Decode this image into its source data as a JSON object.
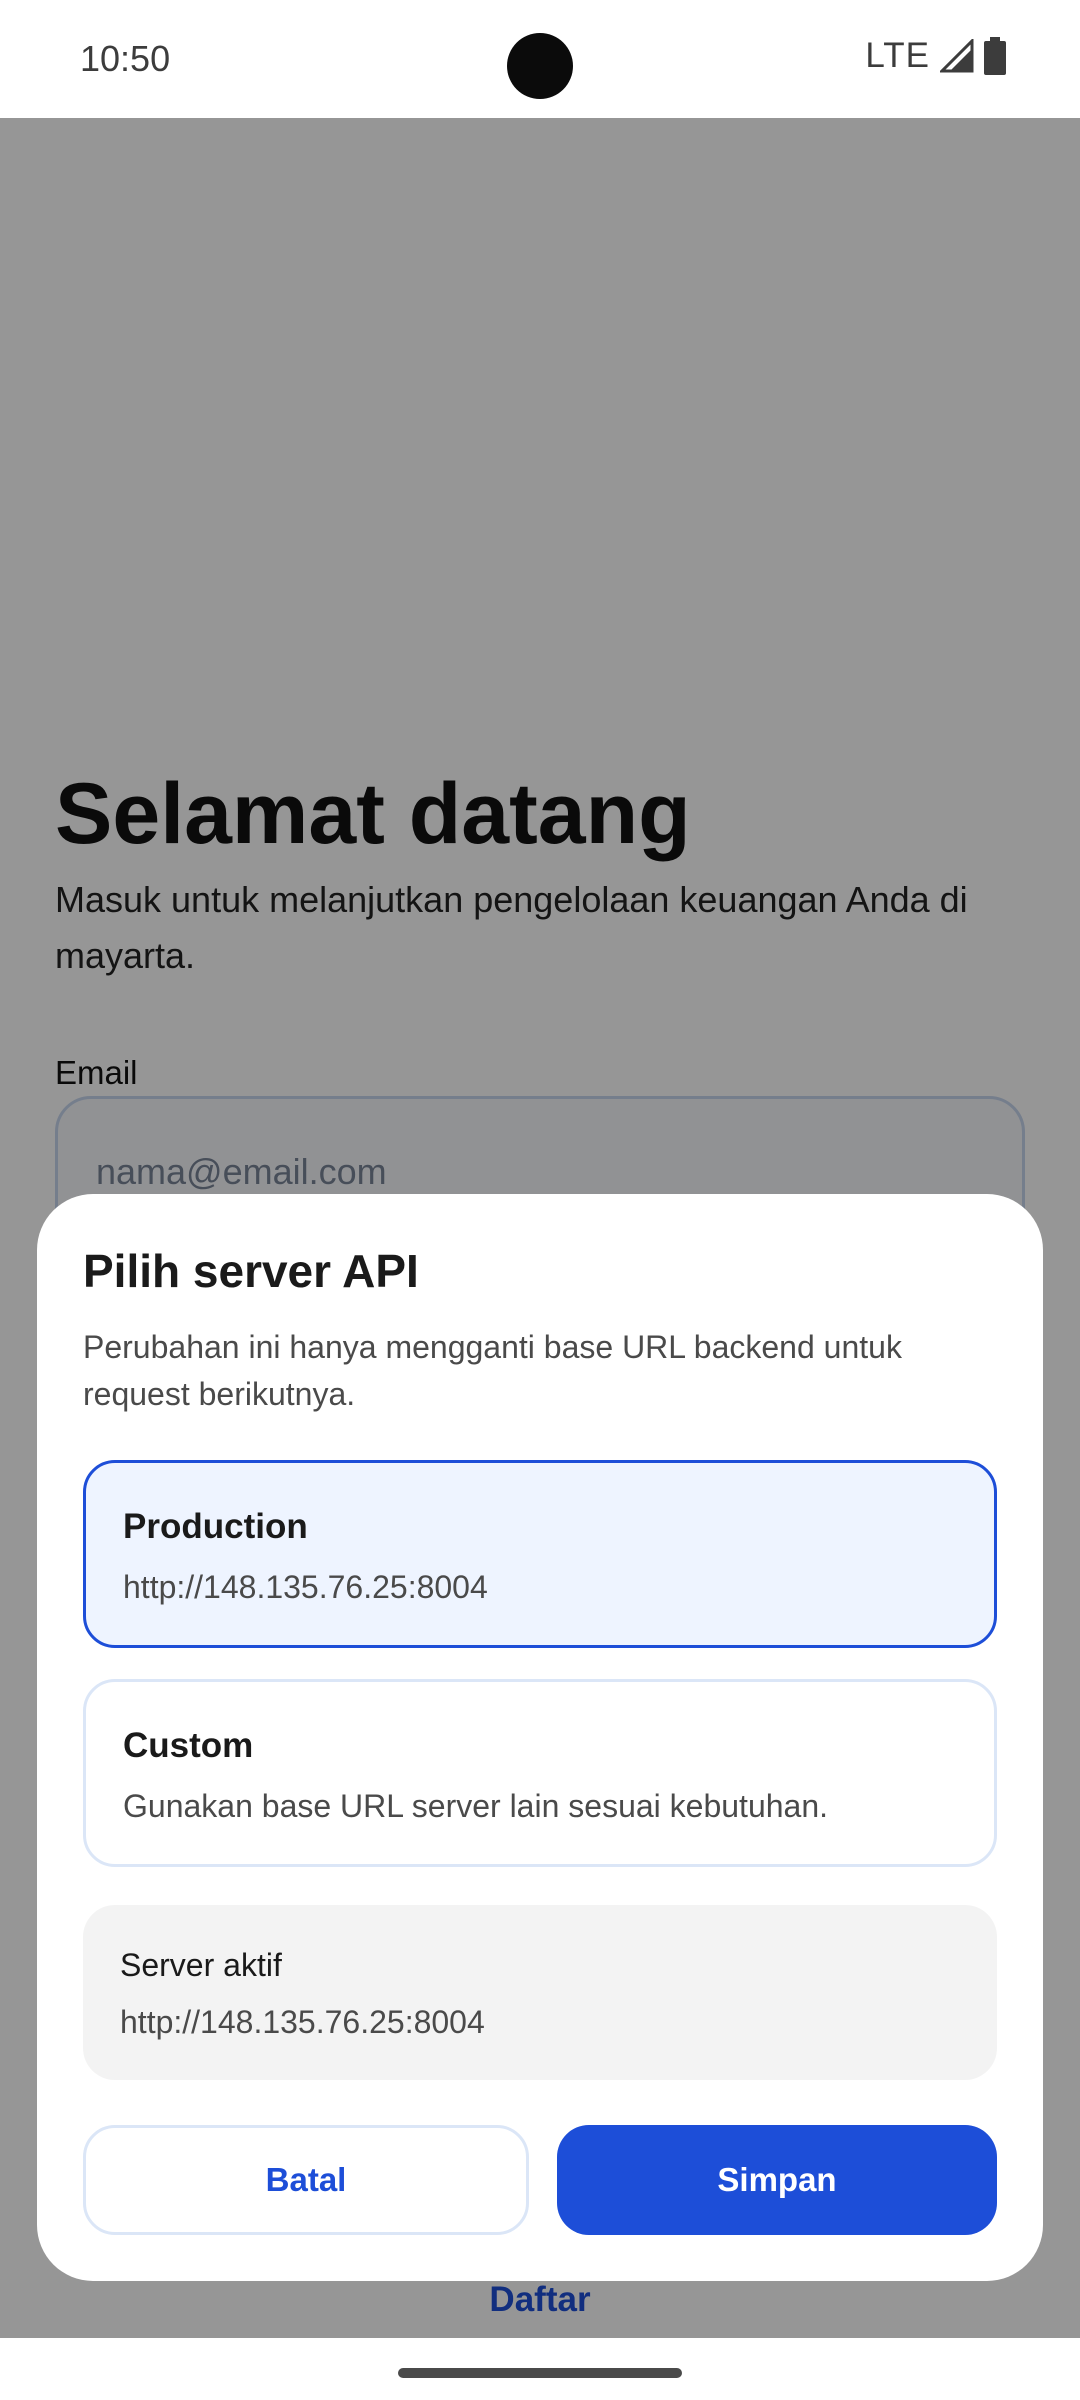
{
  "status_bar": {
    "time": "10:50",
    "network": "LTE"
  },
  "login": {
    "title": "Selamat datang",
    "subtitle": "Masuk untuk melanjutkan pengelolaan keuangan Anda di mayarta.",
    "email_label": "Email",
    "email_placeholder": "nama@email.com",
    "register_link": "Daftar"
  },
  "dialog": {
    "title": "Pilih server API",
    "description": "Perubahan ini hanya mengganti base URL backend untuk request berikutnya.",
    "options": [
      {
        "title": "Production",
        "subtitle": "http://148.135.76.25:8004",
        "selected": true
      },
      {
        "title": "Custom",
        "subtitle": "Gunakan base URL server lain sesuai kebutuhan.",
        "selected": false
      }
    ],
    "active_server": {
      "label": "Server aktif",
      "url": "http://148.135.76.25:8004"
    },
    "cancel_label": "Batal",
    "save_label": "Simpan"
  },
  "colors": {
    "accent": "#1d4ed8",
    "selected_bg": "#eef4ff",
    "scrim": "rgba(0,0,0,0.41)"
  }
}
